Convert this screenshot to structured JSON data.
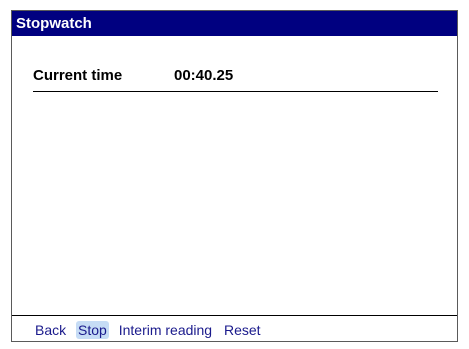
{
  "window": {
    "title": "Stopwatch"
  },
  "timer": {
    "label": "Current time",
    "value": "00:40.25"
  },
  "softkeys": [
    {
      "label": "Back",
      "selected": false
    },
    {
      "label": "Stop",
      "selected": true
    },
    {
      "label": "Interim reading",
      "selected": false
    },
    {
      "label": "Reset",
      "selected": false
    }
  ],
  "colors": {
    "title_bar": "#000080",
    "title_text": "#ffffff",
    "softkey_text": "#1a1a8c",
    "softkey_selected_bg": "#c6dcf5"
  }
}
